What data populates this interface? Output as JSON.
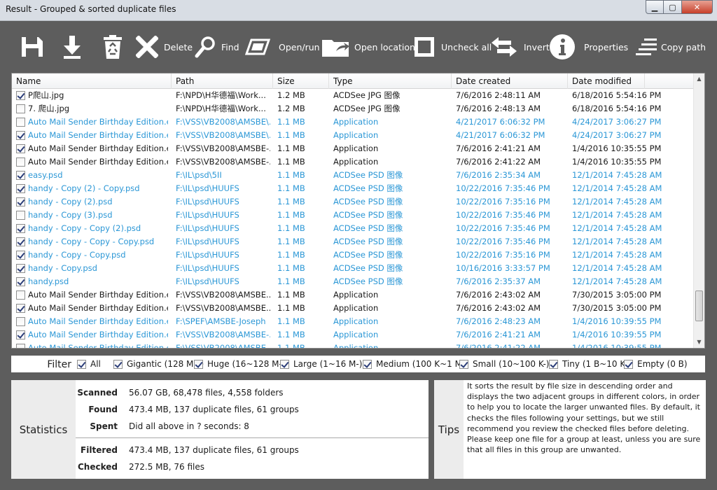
{
  "window": {
    "title": "Result - Grouped & sorted duplicate files",
    "controls": {
      "minimize": "▁",
      "maximize": "▢",
      "close": "✕"
    }
  },
  "toolbar": {
    "delete_label": "Delete",
    "find_label": "Find",
    "openrun_label": "Open/run",
    "open_location_label": "Open location",
    "uncheck_all_label": "Uncheck all",
    "invert_label": "Invert",
    "properties_label": "Properties",
    "copy_path_label": "Copy path"
  },
  "table": {
    "columns": [
      "Name",
      "Path",
      "Size",
      "Type",
      "Date created",
      "Date modified"
    ],
    "rows": [
      {
        "checked": true,
        "alt": false,
        "name": "P爬山.jpg",
        "path": "F:\\NPD\\H华德福\\Work...",
        "size": "1.2 MB",
        "type": "ACDSee JPG 图像",
        "created": "7/6/2016 2:48:11 AM",
        "modified": "6/18/2016 5:54:16 PM"
      },
      {
        "checked": false,
        "alt": false,
        "name": "7. 爬山.jpg",
        "path": "F:\\NPD\\H华德福\\Work...",
        "size": "1.2 MB",
        "type": "ACDSee JPG 图像",
        "created": "7/6/2016 2:48:13 AM",
        "modified": "6/18/2016 5:54:16 PM"
      },
      {
        "checked": false,
        "alt": true,
        "name": "Auto Mail Sender Birthday Edition.exe",
        "path": "F:\\VSS\\VB2008\\AMSBE\\...",
        "size": "1.1 MB",
        "type": "Application",
        "created": "4/21/2017 6:06:32 PM",
        "modified": "4/24/2017 3:06:27 PM"
      },
      {
        "checked": true,
        "alt": true,
        "name": "Auto Mail Sender Birthday Edition.exe",
        "path": "F:\\VSS\\VB2008\\AMSBE\\...",
        "size": "1.1 MB",
        "type": "Application",
        "created": "4/21/2017 6:06:32 PM",
        "modified": "4/24/2017 3:06:27 PM"
      },
      {
        "checked": true,
        "alt": false,
        "name": "Auto Mail Sender Birthday Edition.exe",
        "path": "F:\\VSS\\VB2008\\AMSBE-...",
        "size": "1.1 MB",
        "type": "Application",
        "created": "7/6/2016 2:41:21 AM",
        "modified": "1/4/2016 10:35:55 PM"
      },
      {
        "checked": false,
        "alt": false,
        "name": "Auto Mail Sender Birthday Edition.exe",
        "path": "F:\\VSS\\VB2008\\AMSBE-...",
        "size": "1.1 MB",
        "type": "Application",
        "created": "7/6/2016 2:41:22 AM",
        "modified": "1/4/2016 10:35:55 PM"
      },
      {
        "checked": true,
        "alt": true,
        "name": "easy.psd",
        "path": "F:\\IL\\psd\\5II",
        "size": "1.1 MB",
        "type": "ACDSee PSD 图像",
        "created": "7/6/2016 2:35:34 AM",
        "modified": "12/1/2014 7:45:28 AM"
      },
      {
        "checked": true,
        "alt": true,
        "name": "handy - Copy (2) - Copy.psd",
        "path": "F:\\IL\\psd\\HUUFS",
        "size": "1.1 MB",
        "type": "ACDSee PSD 图像",
        "created": "10/22/2016 7:35:46 PM",
        "modified": "12/1/2014 7:45:28 AM"
      },
      {
        "checked": true,
        "alt": true,
        "name": "handy - Copy (2).psd",
        "path": "F:\\IL\\psd\\HUUFS",
        "size": "1.1 MB",
        "type": "ACDSee PSD 图像",
        "created": "10/22/2016 7:35:16 PM",
        "modified": "12/1/2014 7:45:28 AM"
      },
      {
        "checked": false,
        "alt": true,
        "name": "handy - Copy (3).psd",
        "path": "F:\\IL\\psd\\HUUFS",
        "size": "1.1 MB",
        "type": "ACDSee PSD 图像",
        "created": "10/22/2016 7:35:46 PM",
        "modified": "12/1/2014 7:45:28 AM"
      },
      {
        "checked": true,
        "alt": true,
        "name": "handy - Copy - Copy (2).psd",
        "path": "F:\\IL\\psd\\HUUFS",
        "size": "1.1 MB",
        "type": "ACDSee PSD 图像",
        "created": "10/22/2016 7:35:46 PM",
        "modified": "12/1/2014 7:45:28 AM"
      },
      {
        "checked": true,
        "alt": true,
        "name": "handy - Copy - Copy - Copy.psd",
        "path": "F:\\IL\\psd\\HUUFS",
        "size": "1.1 MB",
        "type": "ACDSee PSD 图像",
        "created": "10/22/2016 7:35:46 PM",
        "modified": "12/1/2014 7:45:28 AM"
      },
      {
        "checked": true,
        "alt": true,
        "name": "handy - Copy - Copy.psd",
        "path": "F:\\IL\\psd\\HUUFS",
        "size": "1.1 MB",
        "type": "ACDSee PSD 图像",
        "created": "10/22/2016 7:35:16 PM",
        "modified": "12/1/2014 7:45:28 AM"
      },
      {
        "checked": true,
        "alt": true,
        "name": "handy - Copy.psd",
        "path": "F:\\IL\\psd\\HUUFS",
        "size": "1.1 MB",
        "type": "ACDSee PSD 图像",
        "created": "10/16/2016 3:33:57 PM",
        "modified": "12/1/2014 7:45:28 AM"
      },
      {
        "checked": true,
        "alt": true,
        "name": "handy.psd",
        "path": "F:\\IL\\psd\\HUUFS",
        "size": "1.1 MB",
        "type": "ACDSee PSD 图像",
        "created": "7/6/2016 2:35:37 AM",
        "modified": "12/1/2014 7:45:28 AM"
      },
      {
        "checked": false,
        "alt": false,
        "name": "Auto Mail Sender Birthday Edition.exe",
        "path": "F:\\VSS\\VB2008\\AMSBE...",
        "size": "1.1 MB",
        "type": "Application",
        "created": "7/6/2016 2:43:02 AM",
        "modified": "7/30/2015 3:05:00 PM"
      },
      {
        "checked": true,
        "alt": false,
        "name": "Auto Mail Sender Birthday Edition.exe",
        "path": "F:\\VSS\\VB2008\\AMSBE...",
        "size": "1.1 MB",
        "type": "Application",
        "created": "7/6/2016 2:43:02 AM",
        "modified": "7/30/2015 3:05:00 PM"
      },
      {
        "checked": false,
        "alt": true,
        "name": "Auto Mail Sender Birthday Edition.exe",
        "path": "F:\\SPEF\\AMSBE-Joseph",
        "size": "1.1 MB",
        "type": "Application",
        "created": "7/6/2016 2:48:23 AM",
        "modified": "1/4/2016 10:39:55 PM"
      },
      {
        "checked": true,
        "alt": true,
        "name": "Auto Mail Sender Birthday Edition.exe",
        "path": "F:\\VSS\\VB2008\\AMSBE-...",
        "size": "1.1 MB",
        "type": "Application",
        "created": "7/6/2016 2:41:21 AM",
        "modified": "1/4/2016 10:39:55 PM"
      },
      {
        "checked": false,
        "alt": true,
        "name": "Auto Mail Sender Birthday Edition.exe",
        "path": "F:\\VSS\\VB2008\\AMSBE-...",
        "size": "1.1 MB",
        "type": "Application",
        "created": "7/6/2016 2:41:22 AM",
        "modified": "1/4/2016 10:39:55 PM"
      }
    ]
  },
  "filter": {
    "label": "Filter",
    "items": [
      {
        "label": "All",
        "checked": true
      },
      {
        "label": "Gigantic (128 M+)",
        "checked": true
      },
      {
        "label": "Huge (16~128 M-)",
        "checked": true
      },
      {
        "label": "Large (1~16 M-)",
        "checked": true
      },
      {
        "label": "Medium (100 K~1 M-)",
        "checked": true
      },
      {
        "label": "Small (10~100 K-)",
        "checked": true
      },
      {
        "label": "Tiny (1 B~10 K-)",
        "checked": true
      },
      {
        "label": "Empty (0 B)",
        "checked": true
      }
    ]
  },
  "statistics": {
    "label": "Statistics",
    "scanned_key": "Scanned",
    "scanned_val": "56.07 GB, 68,478 files, 4,558 folders",
    "found_key": "Found",
    "found_val": "473.4 MB, 137 duplicate files, 61 groups",
    "spent_key": "Spent",
    "spent_val": "Did all above in ? seconds: 8",
    "filtered_key": "Filtered",
    "filtered_val": "473.4 MB, 137 duplicate files, 61 groups",
    "checked_key": "Checked",
    "checked_val": "272.5 MB, 76 files"
  },
  "tips": {
    "label": "Tips",
    "text": "It sorts the result by file size in descending order and displays the two adjacent groups in different colors, in order to help you to locate the larger unwanted files. By default, it checks the files following your settings, but we still recommend you review the checked files before deleting. Please keep one file for a group at least, unless you are sure that all files in this group are unwanted."
  },
  "colors": {
    "background": "#5d5d5d",
    "alt_group_text": "#2b97d6",
    "close_button": "#c7402a"
  }
}
